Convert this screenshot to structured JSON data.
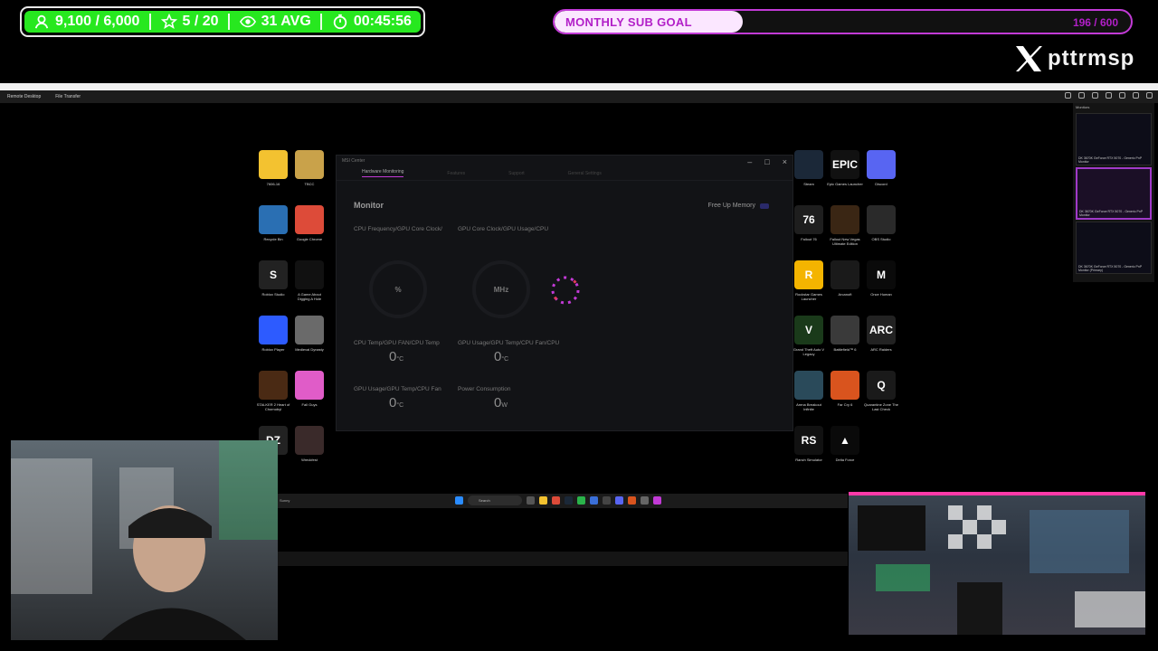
{
  "overlay": {
    "stats": [
      {
        "icon": "person-icon",
        "text": "9,100 / 6,000"
      },
      {
        "icon": "star-icon",
        "text": "5 / 20"
      },
      {
        "icon": "eye-icon",
        "text": "31 AVG"
      },
      {
        "icon": "timer-icon",
        "text": "00:45:56"
      }
    ],
    "goal": {
      "label": "MONTHLY SUB GOAL",
      "count": "196 / 600",
      "progress": 0.327
    },
    "brand": "pttrmsp",
    "colors": {
      "stats_green": "#27e81f",
      "goal_purple": "#c23ad6"
    }
  },
  "remote": {
    "tabs": [
      "Remote Desktop",
      "File Transfer"
    ]
  },
  "desktop": {
    "left_icons": [
      {
        "label": "7606-16",
        "color": "#f3c230",
        "glyph": ""
      },
      {
        "label": "TBCC",
        "color": "#c9a24a",
        "glyph": ""
      },
      {
        "label": "Recycle Bin",
        "color": "#2a6fb3",
        "glyph": ""
      },
      {
        "label": "Google Chrome",
        "color": "#dd4b39",
        "glyph": ""
      },
      {
        "label": "Roblox Studio",
        "color": "#222222",
        "glyph": "S"
      },
      {
        "label": "A Game About Digging A Hole",
        "color": "#111111",
        "glyph": ""
      },
      {
        "label": "Roblox Player",
        "color": "#2d5bff",
        "glyph": ""
      },
      {
        "label": "Medieval Dynasty",
        "color": "#6a6a6a",
        "glyph": ""
      },
      {
        "label": "STALKER 2 Heart of Chornobyl",
        "color": "#4a2a14",
        "glyph": ""
      },
      {
        "label": "Fall Guys",
        "color": "#e05cc8",
        "glyph": ""
      },
      {
        "label": "DayZ",
        "color": "#222222",
        "glyph": "DZ"
      },
      {
        "label": "Wreckfest",
        "color": "#3a2a2a",
        "glyph": ""
      }
    ],
    "right_icons": [
      {
        "label": "Steam",
        "color": "#1b2838",
        "glyph": ""
      },
      {
        "label": "Epic Games Launcher",
        "color": "#111111",
        "glyph": "EPIC"
      },
      {
        "label": "Discord",
        "color": "#5865f2",
        "glyph": ""
      },
      {
        "label": "Fallout 76",
        "color": "#1e1e1e",
        "glyph": "76"
      },
      {
        "label": "Fallout New Vegas Ultimate Edition",
        "color": "#3a2614",
        "glyph": ""
      },
      {
        "label": "OBS Studio",
        "color": "#2a2a2a",
        "glyph": ""
      },
      {
        "label": "Rockstar Games Launcher",
        "color": "#f4b400",
        "glyph": "R"
      },
      {
        "label": "Arcanoft",
        "color": "#1a1a1a",
        "glyph": ""
      },
      {
        "label": "Once Human",
        "color": "#0a0a0a",
        "glyph": "M"
      },
      {
        "label": "Grand Theft Auto V Legacy",
        "color": "#1a3a1a",
        "glyph": "V"
      },
      {
        "label": "Battlefield™ 6",
        "color": "#3a3a3a",
        "glyph": ""
      },
      {
        "label": "ARC Raiders",
        "color": "#222222",
        "glyph": "ARC"
      },
      {
        "label": "Arena Breakout Infinite",
        "color": "#2a4a5a",
        "glyph": ""
      },
      {
        "label": "Far Cry 6",
        "color": "#d9541e",
        "glyph": ""
      },
      {
        "label": "Quarantine Zone The Last Check",
        "color": "#1a1a1a",
        "glyph": "Q"
      },
      {
        "label": "Ranch Simulator",
        "color": "#111111",
        "glyph": "RS"
      },
      {
        "label": "Delta Force",
        "color": "#0a0a0a",
        "glyph": "▲"
      }
    ]
  },
  "msi": {
    "title": "MSI Center",
    "tabs": [
      "Hardware Monitoring",
      "Features",
      "Support",
      "General Settings"
    ],
    "heading": "Monitor",
    "free_memory": "Free Up Memory",
    "labels": {
      "l1": "CPU Frequency/GPU Core Clock/",
      "l2": "GPU Core Clock/GPU Usage/CPU",
      "l3": "CPU Temp/GPU FAN/CPU Temp",
      "l4": "GPU Usage/GPU Temp/CPU Fan/CPU",
      "l5": "GPU Usage/GPU Temp/CPU Fan",
      "l6": "Power Consumption"
    },
    "gauges": {
      "g1": "%",
      "g2": "MHz"
    },
    "values": {
      "v3": "0",
      "v4": "0",
      "v5": "0",
      "v6": "0"
    },
    "units": {
      "u3": "°C",
      "u4": "°C",
      "u5": "°C",
      "u6": "W"
    }
  },
  "taskbar": {
    "weather": "Sunny",
    "search": "Search"
  },
  "monitors": {
    "title": "Monitors",
    "items": [
      "DK 3670K GeForce RTX 5070 - Generic PnP Monitor",
      "DK 3670K GeForce RTX 5070 - Generic PnP Monitor",
      "DK 3670K GeForce RTX 5070 - Generic PnP Monitor (Primary)"
    ]
  }
}
